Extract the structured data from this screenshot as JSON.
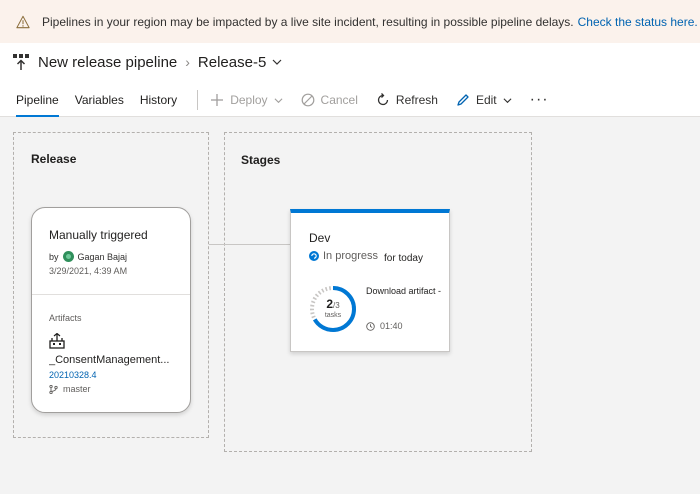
{
  "banner": {
    "message": "Pipelines in your region may be impacted by a live site incident, resulting in possible pipeline delays.",
    "link": "Check the status here."
  },
  "breadcrumb": {
    "pipeline": "New release pipeline",
    "release": "Release-5"
  },
  "tabs": [
    {
      "label": "Pipeline",
      "active": true
    },
    {
      "label": "Variables",
      "active": false
    },
    {
      "label": "History",
      "active": false
    }
  ],
  "toolbar": {
    "deploy": "Deploy",
    "cancel": "Cancel",
    "refresh": "Refresh",
    "edit": "Edit",
    "more": "···"
  },
  "release_zone": {
    "title": "Release",
    "card": {
      "trigger": "Manually triggered",
      "by_prefix": "by",
      "user": "Gagan Bajaj",
      "date": "3/29/2021, 4:39 AM",
      "artifacts_label": "Artifacts",
      "artifact_name": "_ConsentManagement...",
      "artifact_version": "20210328.4",
      "branch": "master"
    }
  },
  "stages_zone": {
    "title": "Stages",
    "stage": {
      "name": "Dev",
      "status": "In progress",
      "when": "for today",
      "tasks_done": "2",
      "tasks_total": "/3",
      "tasks_label": "tasks",
      "tasks_fraction": 0.6667,
      "current_task": "Download artifact -",
      "elapsed": "01:40"
    }
  },
  "colors": {
    "accent": "#0078d4",
    "link": "#0063b1",
    "banner_bg": "#fbf2ec",
    "warning": "#d83b01"
  }
}
